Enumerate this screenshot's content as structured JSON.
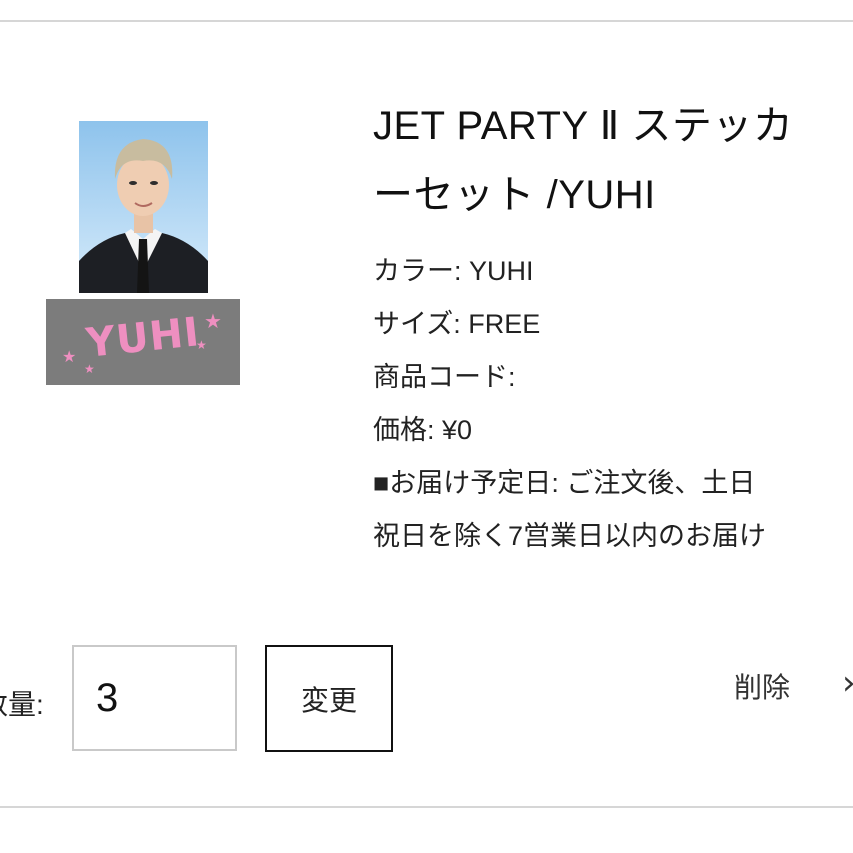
{
  "product": {
    "title_line1": "JET PARTY Ⅱ ステッカ",
    "title_line2": "ーセット /YUHI",
    "sticker_name": "YUHI",
    "info": {
      "color_label": "カラー",
      "color_value": "YUHI",
      "size_label": "サイズ",
      "size_value": "FREE",
      "code_label": "商品コード",
      "code_value": "",
      "price_label": "価格",
      "price_value": "¥0",
      "delivery_label": "■お届け予定日",
      "delivery_value": "ご注文後、土日",
      "delivery_line2": "祝日を除く7営業日以内のお届け"
    }
  },
  "controls": {
    "quantity_label": "数量:",
    "quantity_value": "3",
    "change_label": "変更",
    "delete_label": "削除",
    "chevron": "›"
  },
  "colors": {
    "sticker_bg": "#7c7c7c",
    "sticker_text": "#ee8fc0",
    "border": "#c9c9c9"
  }
}
